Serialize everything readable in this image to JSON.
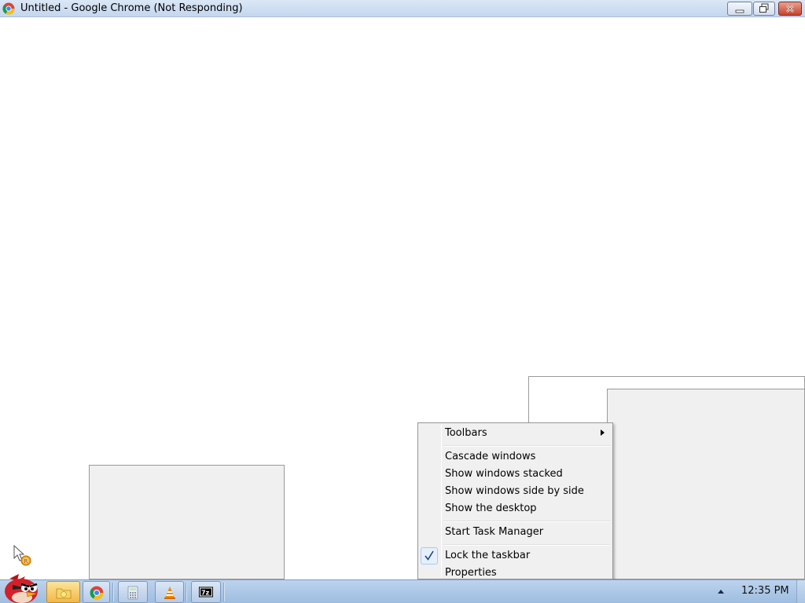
{
  "window": {
    "title": "Untitled - Google Chrome (Not Responding)",
    "app_icon": "chrome-icon",
    "buttons": [
      "minimize-icon",
      "restore-icon",
      "close-icon"
    ]
  },
  "context_menu": {
    "items": [
      {
        "label": "Toolbars",
        "has_submenu": true
      },
      {
        "label": "Cascade windows"
      },
      {
        "label": "Show windows stacked"
      },
      {
        "label": "Show windows side by side"
      },
      {
        "label": "Show the desktop"
      },
      {
        "label": "Start Task Manager"
      },
      {
        "label": "Lock the taskbar",
        "checked": true
      },
      {
        "label": "Properties"
      }
    ]
  },
  "taskbar": {
    "start_icon": "angry-birds-start-icon",
    "pinned": [
      {
        "name": "explorer-folder-icon",
        "active": true
      },
      {
        "name": "chrome-icon"
      },
      {
        "name": "calculator-icon"
      },
      {
        "name": "vlc-icon"
      },
      {
        "name": "7zip-icon",
        "text": "7z"
      }
    ],
    "clock": "12:35 PM",
    "tray_arrow": "show-hidden-icons-icon"
  },
  "colors": {
    "taskbar": "#a9c4e4",
    "menu_bg": "#f0f0f0",
    "close_button": "#c7432b"
  }
}
